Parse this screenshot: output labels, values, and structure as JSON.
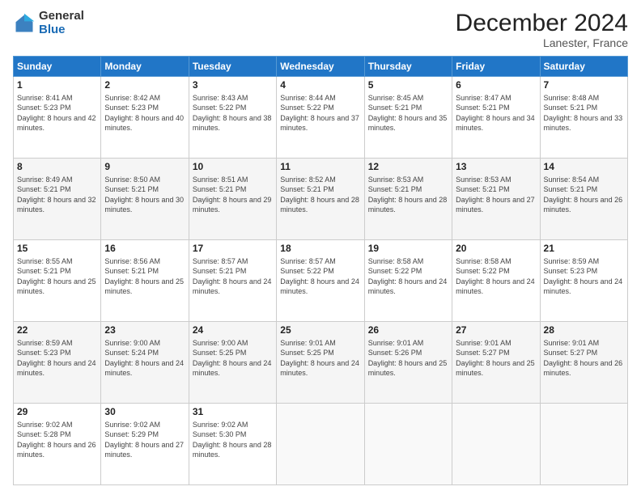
{
  "logo": {
    "general": "General",
    "blue": "Blue"
  },
  "header": {
    "month": "December 2024",
    "location": "Lanester, France"
  },
  "weekdays": [
    "Sunday",
    "Monday",
    "Tuesday",
    "Wednesday",
    "Thursday",
    "Friday",
    "Saturday"
  ],
  "weeks": [
    [
      {
        "day": "1",
        "sunrise": "8:41 AM",
        "sunset": "5:23 PM",
        "daylight": "8 hours and 42 minutes."
      },
      {
        "day": "2",
        "sunrise": "8:42 AM",
        "sunset": "5:23 PM",
        "daylight": "8 hours and 40 minutes."
      },
      {
        "day": "3",
        "sunrise": "8:43 AM",
        "sunset": "5:22 PM",
        "daylight": "8 hours and 38 minutes."
      },
      {
        "day": "4",
        "sunrise": "8:44 AM",
        "sunset": "5:22 PM",
        "daylight": "8 hours and 37 minutes."
      },
      {
        "day": "5",
        "sunrise": "8:45 AM",
        "sunset": "5:21 PM",
        "daylight": "8 hours and 35 minutes."
      },
      {
        "day": "6",
        "sunrise": "8:47 AM",
        "sunset": "5:21 PM",
        "daylight": "8 hours and 34 minutes."
      },
      {
        "day": "7",
        "sunrise": "8:48 AM",
        "sunset": "5:21 PM",
        "daylight": "8 hours and 33 minutes."
      }
    ],
    [
      {
        "day": "8",
        "sunrise": "8:49 AM",
        "sunset": "5:21 PM",
        "daylight": "8 hours and 32 minutes."
      },
      {
        "day": "9",
        "sunrise": "8:50 AM",
        "sunset": "5:21 PM",
        "daylight": "8 hours and 30 minutes."
      },
      {
        "day": "10",
        "sunrise": "8:51 AM",
        "sunset": "5:21 PM",
        "daylight": "8 hours and 29 minutes."
      },
      {
        "day": "11",
        "sunrise": "8:52 AM",
        "sunset": "5:21 PM",
        "daylight": "8 hours and 28 minutes."
      },
      {
        "day": "12",
        "sunrise": "8:53 AM",
        "sunset": "5:21 PM",
        "daylight": "8 hours and 28 minutes."
      },
      {
        "day": "13",
        "sunrise": "8:53 AM",
        "sunset": "5:21 PM",
        "daylight": "8 hours and 27 minutes."
      },
      {
        "day": "14",
        "sunrise": "8:54 AM",
        "sunset": "5:21 PM",
        "daylight": "8 hours and 26 minutes."
      }
    ],
    [
      {
        "day": "15",
        "sunrise": "8:55 AM",
        "sunset": "5:21 PM",
        "daylight": "8 hours and 25 minutes."
      },
      {
        "day": "16",
        "sunrise": "8:56 AM",
        "sunset": "5:21 PM",
        "daylight": "8 hours and 25 minutes."
      },
      {
        "day": "17",
        "sunrise": "8:57 AM",
        "sunset": "5:21 PM",
        "daylight": "8 hours and 24 minutes."
      },
      {
        "day": "18",
        "sunrise": "8:57 AM",
        "sunset": "5:22 PM",
        "daylight": "8 hours and 24 minutes."
      },
      {
        "day": "19",
        "sunrise": "8:58 AM",
        "sunset": "5:22 PM",
        "daylight": "8 hours and 24 minutes."
      },
      {
        "day": "20",
        "sunrise": "8:58 AM",
        "sunset": "5:22 PM",
        "daylight": "8 hours and 24 minutes."
      },
      {
        "day": "21",
        "sunrise": "8:59 AM",
        "sunset": "5:23 PM",
        "daylight": "8 hours and 24 minutes."
      }
    ],
    [
      {
        "day": "22",
        "sunrise": "8:59 AM",
        "sunset": "5:23 PM",
        "daylight": "8 hours and 24 minutes."
      },
      {
        "day": "23",
        "sunrise": "9:00 AM",
        "sunset": "5:24 PM",
        "daylight": "8 hours and 24 minutes."
      },
      {
        "day": "24",
        "sunrise": "9:00 AM",
        "sunset": "5:25 PM",
        "daylight": "8 hours and 24 minutes."
      },
      {
        "day": "25",
        "sunrise": "9:01 AM",
        "sunset": "5:25 PM",
        "daylight": "8 hours and 24 minutes."
      },
      {
        "day": "26",
        "sunrise": "9:01 AM",
        "sunset": "5:26 PM",
        "daylight": "8 hours and 25 minutes."
      },
      {
        "day": "27",
        "sunrise": "9:01 AM",
        "sunset": "5:27 PM",
        "daylight": "8 hours and 25 minutes."
      },
      {
        "day": "28",
        "sunrise": "9:01 AM",
        "sunset": "5:27 PM",
        "daylight": "8 hours and 26 minutes."
      }
    ],
    [
      {
        "day": "29",
        "sunrise": "9:02 AM",
        "sunset": "5:28 PM",
        "daylight": "8 hours and 26 minutes."
      },
      {
        "day": "30",
        "sunrise": "9:02 AM",
        "sunset": "5:29 PM",
        "daylight": "8 hours and 27 minutes."
      },
      {
        "day": "31",
        "sunrise": "9:02 AM",
        "sunset": "5:30 PM",
        "daylight": "8 hours and 28 minutes."
      },
      null,
      null,
      null,
      null
    ]
  ]
}
